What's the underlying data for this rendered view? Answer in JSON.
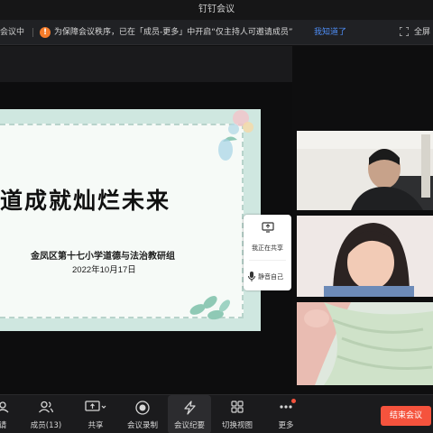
{
  "window": {
    "title": "钉钉会议"
  },
  "notice": {
    "left_text": "会议中",
    "warning_icon": "warning-icon",
    "message": "为保障会议秩序，已在「成员-更多」中开启“仅主持人可邀请成员”",
    "ack_label": "我知道了",
    "fullscreen_label": "全屏"
  },
  "slide": {
    "title": "道成就灿烂未来",
    "org": "金凤区第十七小学道德与法治教研组",
    "date": "2022年10月17日"
  },
  "share_panel": {
    "sharing_label": "我正在共享",
    "muted_label": "静音自己"
  },
  "toolbar": {
    "items": [
      {
        "label": "请",
        "icon": "invite-icon"
      },
      {
        "label": "成员(13)",
        "icon": "members-icon"
      },
      {
        "label": "共享",
        "icon": "share-screen-icon"
      },
      {
        "label": "会议录制",
        "icon": "record-icon"
      },
      {
        "label": "会议纪要",
        "icon": "minutes-icon"
      },
      {
        "label": "切换视图",
        "icon": "grid-view-icon"
      },
      {
        "label": "更多",
        "icon": "more-icon"
      }
    ],
    "end_label": "结束会议"
  },
  "colors": {
    "accent": "#4e8df5",
    "end": "#f5533d",
    "warning": "#f57c2a"
  }
}
